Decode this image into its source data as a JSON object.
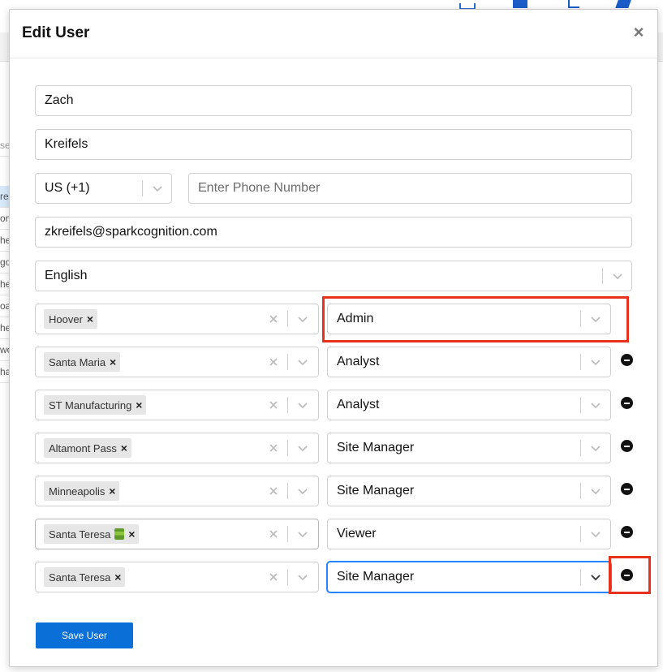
{
  "background": {
    "rows": [
      "re",
      "on",
      "he",
      "go",
      "he",
      "oat",
      "he",
      "wo",
      "ha"
    ],
    "header_fragment": "se"
  },
  "modal": {
    "title": "Edit User",
    "close_label": "×"
  },
  "form": {
    "first_name": "Zach",
    "last_name": "Kreifels",
    "country_code": "US (+1)",
    "phone_placeholder": "Enter Phone Number",
    "phone_value": "",
    "email": "zkreifels@sparkcognition.com",
    "language": "English"
  },
  "assignments": [
    {
      "site": "Hoover",
      "role": "Admin",
      "removable": false
    },
    {
      "site": "Santa Maria",
      "role": "Analyst",
      "removable": true
    },
    {
      "site": "ST Manufacturing",
      "role": "Analyst",
      "removable": true
    },
    {
      "site": "Altamont Pass",
      "role": "Site Manager",
      "removable": true
    },
    {
      "site": "Minneapolis",
      "role": "Site Manager",
      "removable": true
    },
    {
      "site": "Santa Teresa",
      "site_icon": "battery-emoji-icon",
      "role": "Viewer",
      "removable": true
    },
    {
      "site": "Santa Teresa",
      "role": "Site Manager",
      "removable": true
    }
  ],
  "save_button": "Save User",
  "colors": {
    "accent": "#0a6fd6",
    "highlight": "#e8321e",
    "focus_border": "#2684ff"
  }
}
